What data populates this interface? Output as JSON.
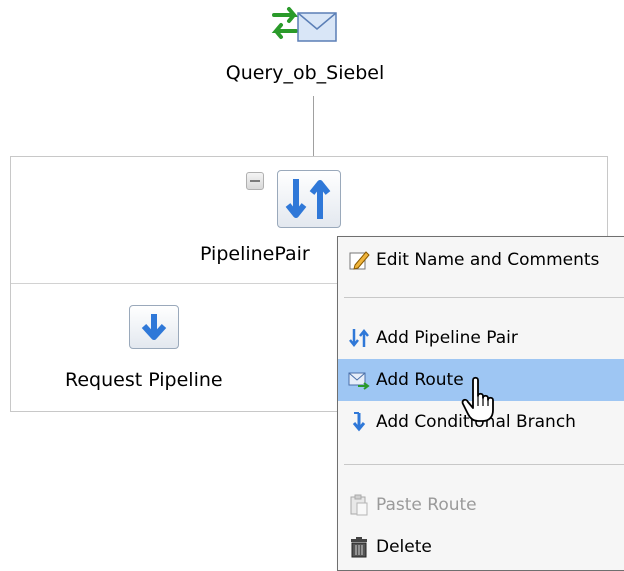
{
  "proxy": {
    "name": "Query_ob_Siebel",
    "icon": "proxy-service-envelope-icon"
  },
  "pipeline_pair": {
    "label": "PipelinePair",
    "icon": "pipeline-pair-icon",
    "collapse_icon": "collapse-minus-icon"
  },
  "request_pipeline": {
    "label": "Request Pipeline",
    "icon": "request-pipeline-down-arrow-icon"
  },
  "context_menu": {
    "items": [
      {
        "label": "Edit Name and Comments",
        "icon": "edit-pencil-icon",
        "state": "normal"
      },
      {
        "label": "Add Pipeline Pair",
        "icon": "pipeline-pair-icon",
        "state": "normal"
      },
      {
        "label": "Add Route",
        "icon": "route-envelope-icon",
        "state": "highlighted"
      },
      {
        "label": "Add Conditional Branch",
        "icon": "conditional-branch-icon",
        "state": "normal"
      },
      {
        "label": "Paste Route",
        "icon": "paste-clipboard-icon",
        "state": "disabled"
      },
      {
        "label": "Delete",
        "icon": "trash-can-icon",
        "state": "normal"
      }
    ]
  },
  "colors": {
    "highlight": "#9ec6f3",
    "frame_border": "#c8c8c8",
    "disabled_text": "#9a9a9a",
    "arrow_blue": "#2f78d8"
  }
}
